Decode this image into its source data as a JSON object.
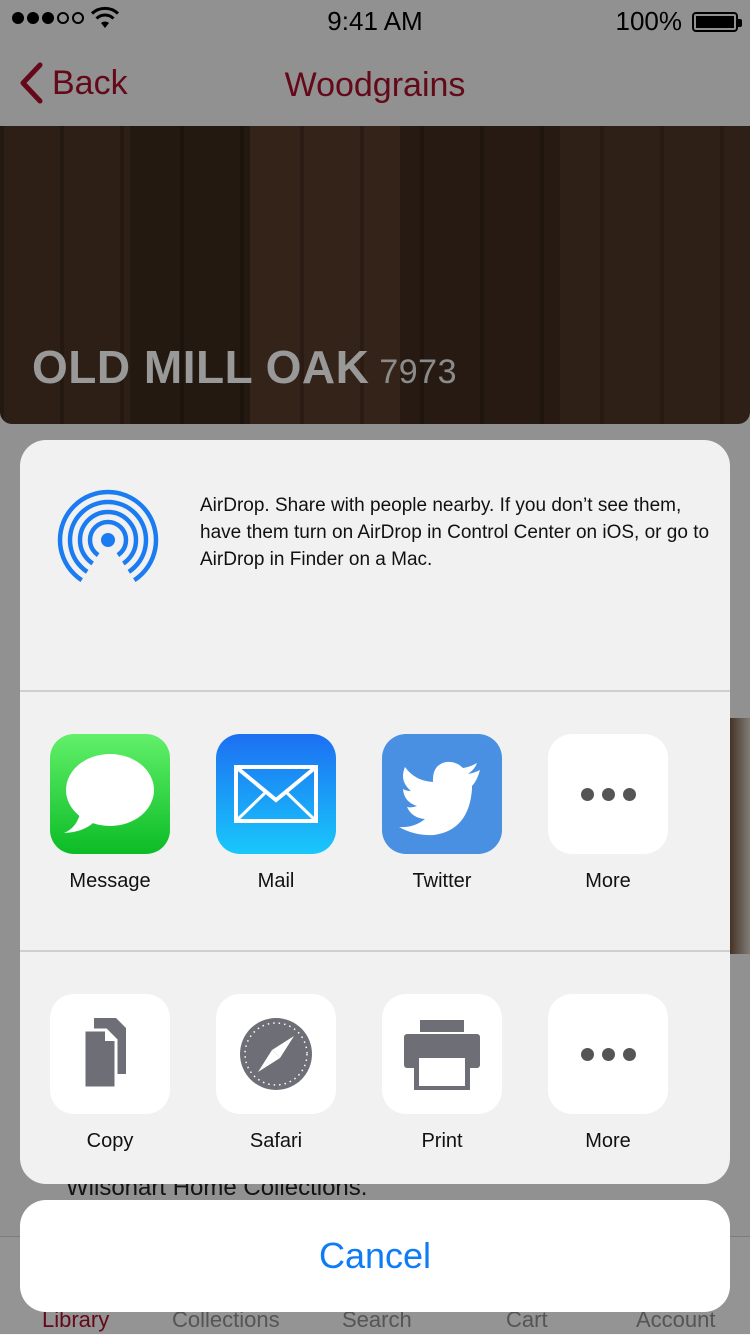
{
  "status_bar": {
    "time": "9:41 AM",
    "battery": "100%"
  },
  "nav": {
    "back_label": "Back",
    "title": "Woodgrains"
  },
  "hero": {
    "name": "OLD MILL OAK",
    "code": "7973"
  },
  "background_text": "Wilsonart Home Collections.",
  "tab_bar": {
    "tabs": [
      "Library",
      "Collections",
      "Search",
      "Cart",
      "Account"
    ],
    "selected": "Library"
  },
  "share_sheet": {
    "airdrop_text": "AirDrop. Share with people nearby. If you don’t see them, have them turn on AirDrop in Control Center on iOS, or go to AirDrop in Finder on a Mac.",
    "share_row": [
      {
        "label": "Message",
        "icon": "message-icon"
      },
      {
        "label": "Mail",
        "icon": "mail-icon"
      },
      {
        "label": "Twitter",
        "icon": "twitter-icon"
      },
      {
        "label": "More",
        "icon": "more-icon"
      }
    ],
    "action_row": [
      {
        "label": "Copy",
        "icon": "copy-icon"
      },
      {
        "label": "Safari",
        "icon": "safari-icon"
      },
      {
        "label": "Print",
        "icon": "print-icon"
      },
      {
        "label": "More",
        "icon": "more-icon"
      }
    ],
    "cancel_label": "Cancel"
  },
  "colors": {
    "brand": "#a6102c",
    "ios_blue": "#0e7cf4",
    "sheet_bg": "#f1f1f1"
  }
}
